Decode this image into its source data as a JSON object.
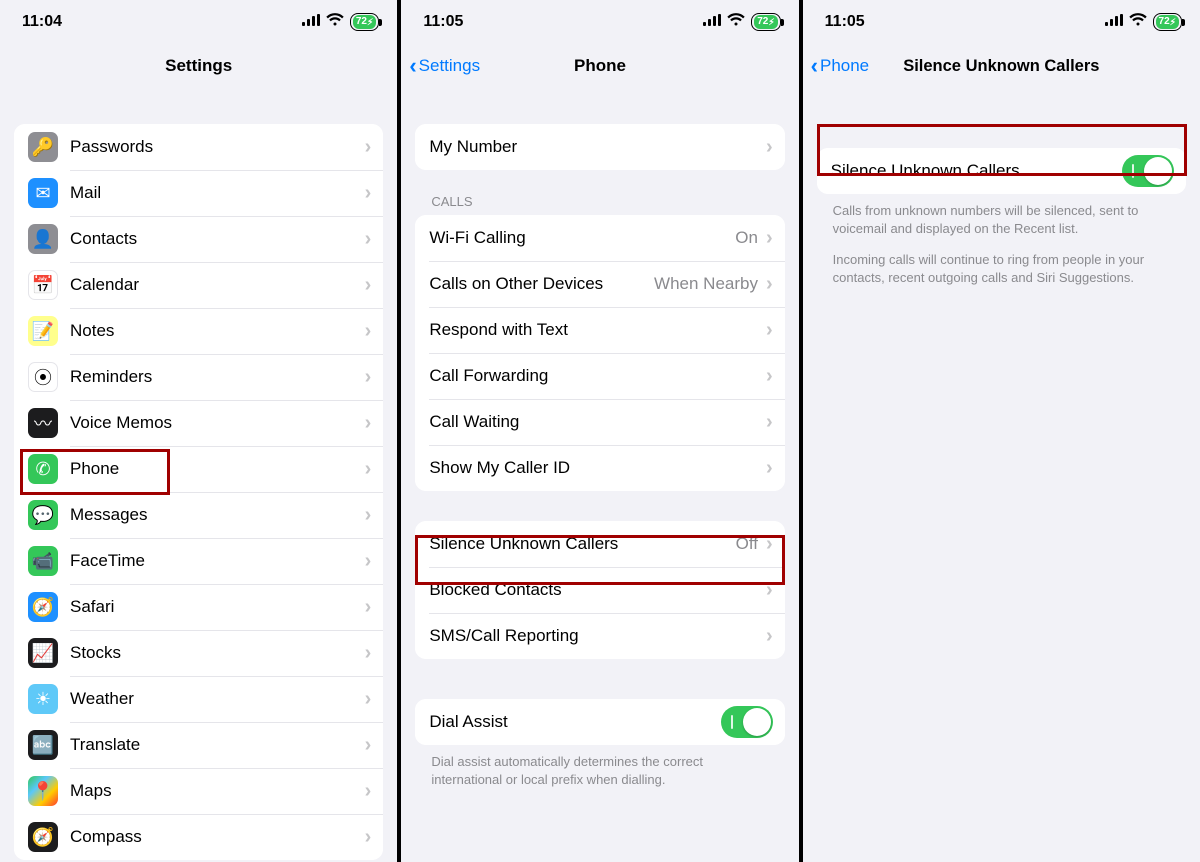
{
  "status": {
    "battery": "72",
    "bolt": "⚡︎"
  },
  "screen1": {
    "time": "11:04",
    "title": "Settings",
    "rows": [
      {
        "label": "Passwords",
        "icon": "key-icon",
        "bg": "ic-gray",
        "glyph": "🔑"
      },
      {
        "label": "Mail",
        "icon": "mail-icon",
        "bg": "ic-blue",
        "glyph": "✉︎"
      },
      {
        "label": "Contacts",
        "icon": "contacts-icon",
        "bg": "ic-gray",
        "glyph": "👤"
      },
      {
        "label": "Calendar",
        "icon": "calendar-icon",
        "bg": "",
        "glyph": "📅"
      },
      {
        "label": "Notes",
        "icon": "notes-icon",
        "bg": "ic-yel",
        "glyph": "📝"
      },
      {
        "label": "Reminders",
        "icon": "reminders-icon",
        "bg": "",
        "glyph": "⦿"
      },
      {
        "label": "Voice Memos",
        "icon": "voice-memos-icon",
        "bg": "ic-dark",
        "glyph": "〰"
      },
      {
        "label": "Phone",
        "icon": "phone-icon",
        "bg": "ic-green",
        "glyph": "✆"
      },
      {
        "label": "Messages",
        "icon": "messages-icon",
        "bg": "ic-green",
        "glyph": "💬"
      },
      {
        "label": "FaceTime",
        "icon": "facetime-icon",
        "bg": "ic-green",
        "glyph": "📹"
      },
      {
        "label": "Safari",
        "icon": "safari-icon",
        "bg": "ic-blue",
        "glyph": "🧭"
      },
      {
        "label": "Stocks",
        "icon": "stocks-icon",
        "bg": "ic-dark",
        "glyph": "📈"
      },
      {
        "label": "Weather",
        "icon": "weather-icon",
        "bg": "ic-sky",
        "glyph": "☀︎"
      },
      {
        "label": "Translate",
        "icon": "translate-icon",
        "bg": "ic-dark",
        "glyph": "🔤"
      },
      {
        "label": "Maps",
        "icon": "maps-icon",
        "bg": "ic-multi",
        "glyph": "📍"
      },
      {
        "label": "Compass",
        "icon": "compass-icon",
        "bg": "ic-dark",
        "glyph": "🧭"
      }
    ]
  },
  "screen2": {
    "time": "11:05",
    "back": "Settings",
    "title": "Phone",
    "my_number": "My Number",
    "calls_hdr": "CALLS",
    "calls": [
      {
        "label": "Wi-Fi Calling",
        "value": "On"
      },
      {
        "label": "Calls on Other Devices",
        "value": "When Nearby"
      },
      {
        "label": "Respond with Text",
        "value": ""
      },
      {
        "label": "Call Forwarding",
        "value": ""
      },
      {
        "label": "Call Waiting",
        "value": ""
      },
      {
        "label": "Show My Caller ID",
        "value": ""
      }
    ],
    "block_rows": [
      {
        "label": "Silence Unknown Callers",
        "value": "Off"
      },
      {
        "label": "Blocked Contacts",
        "value": ""
      },
      {
        "label": "SMS/Call Reporting",
        "value": ""
      }
    ],
    "dial_assist": "Dial Assist",
    "dial_ftr": "Dial assist automatically determines the correct international or local prefix when dialling."
  },
  "screen3": {
    "time": "11:05",
    "back": "Phone",
    "title": "Silence Unknown Callers",
    "row_label": "Silence Unknown Callers",
    "ftr1": "Calls from unknown numbers will be silenced, sent to voicemail and displayed on the Recent list.",
    "ftr2": "Incoming calls will continue to ring from people in your contacts, recent outgoing calls and Siri Suggestions."
  }
}
